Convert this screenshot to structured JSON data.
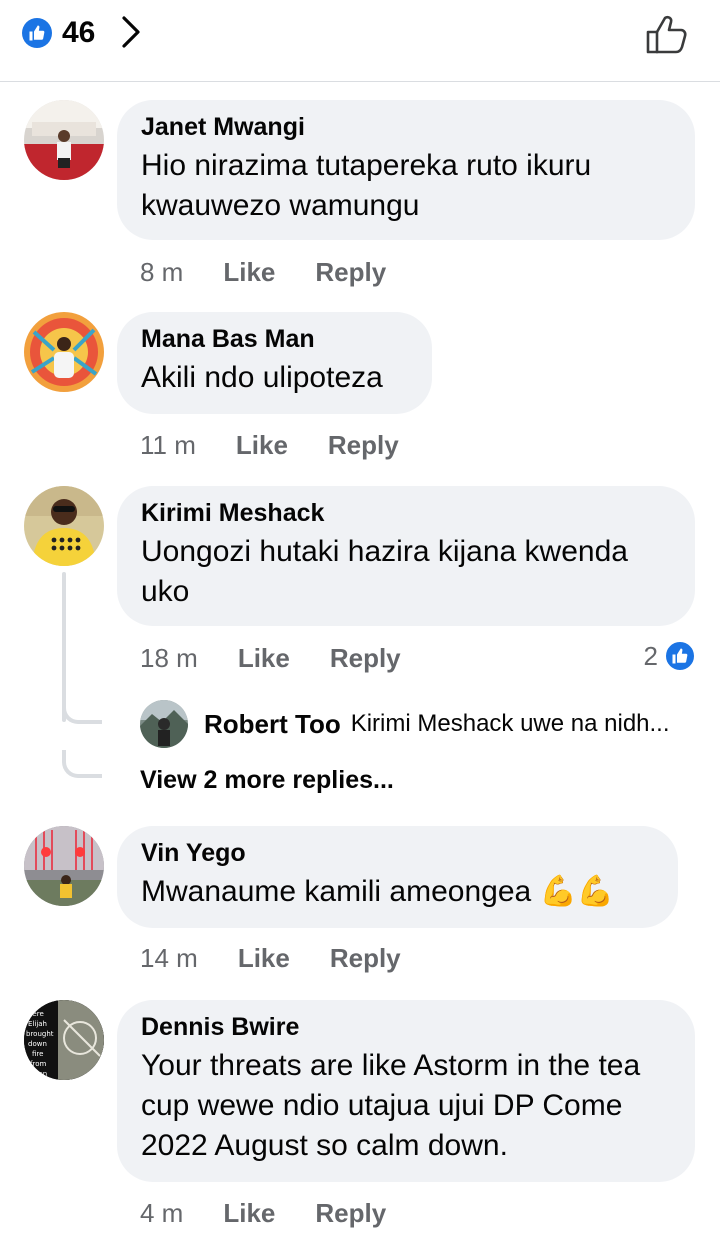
{
  "header": {
    "like_count": "46",
    "icons": [
      "like-badge-icon",
      "chevron-right-icon",
      "thumbs-up-outline-icon"
    ]
  },
  "comments": [
    {
      "author": "Janet Mwangi",
      "text": "Hio nirazima tutapereka ruto ikuru kwauwezo wamungu",
      "time": "8 m",
      "like": "Like",
      "reply": "Reply"
    },
    {
      "author": "Mana Bas Man",
      "text": "Akili ndo ulipoteza",
      "time": "11 m",
      "like": "Like",
      "reply": "Reply"
    },
    {
      "author": "Kirimi Meshack",
      "text": "Uongozi hutaki hazira kijana kwenda uko",
      "time": "18 m",
      "like": "Like",
      "reply": "Reply",
      "reactions": "2"
    },
    {
      "author": "Vin Yego",
      "text": "Mwanaume kamili ameongea",
      "emoji": "💪💪",
      "time": "14 m",
      "like": "Like",
      "reply": "Reply"
    },
    {
      "author": "Dennis Bwire",
      "text": "Your threats are like Astorm in the tea cup wewe ndio utajua ujui DP Come 2022 August so calm down.",
      "time": "4 m",
      "like": "Like",
      "reply": "Reply"
    }
  ],
  "reply_preview": {
    "author": "Robert Too",
    "text": "Kirimi Meshack uwe na nidh..."
  },
  "view_more": "View 2 more replies...",
  "avatar_text_dennis": "here Elijah brought down fire from hen",
  "colors": {
    "accent": "#1b74e4",
    "bubble": "#f0f2f5",
    "muted": "#65676b"
  }
}
